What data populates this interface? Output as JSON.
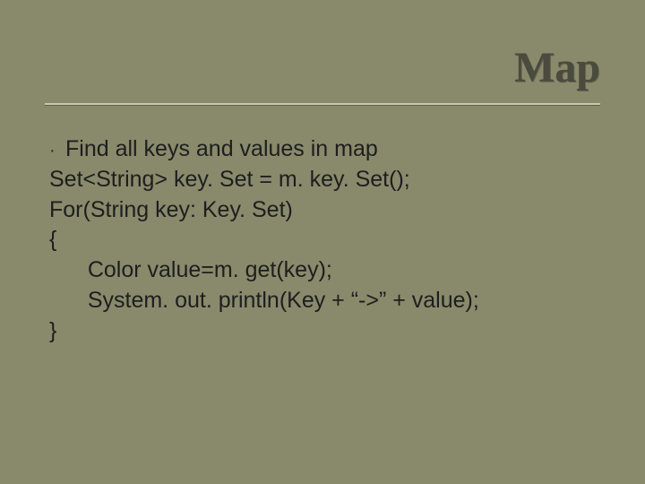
{
  "title": "Map",
  "bullet": "Find all keys and values in map",
  "code": {
    "l1": "Set<String> key. Set = m. key. Set();",
    "l2": "For(String key: Key. Set)",
    "l3": "{",
    "l4": "   Color value=m. get(key);",
    "l5": "   System. out. println(Key + “->” + value);",
    "l6": "}"
  },
  "bullet_glyph": "·"
}
